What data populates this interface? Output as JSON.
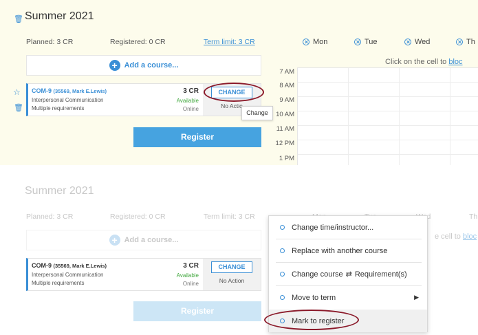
{
  "top": {
    "term_title": "Summer 2021",
    "planned": "Planned: 3 CR",
    "registered": "Registered: 0 CR",
    "term_limit": "Term limit: 3 CR",
    "days": [
      "Mon",
      "Tue",
      "Wed",
      "Th"
    ],
    "add_course": "Add a course...",
    "course": {
      "code": "COM-9",
      "detail": "(35569, Mark E.Lewis)",
      "name": "Interpersonal Communication",
      "requirements": "Multiple requirements",
      "credits": "3 CR",
      "availability": "Available",
      "mode": "Online",
      "change_label": "CHANGE",
      "action_label": "No Actio"
    },
    "tooltip": "Change",
    "register_label": "Register",
    "times": [
      "7 AM",
      "8 AM",
      "9 AM",
      "10 AM",
      "11 AM",
      "12 PM",
      "1 PM"
    ],
    "hint_text": "Click on the cell to ",
    "hint_link": "bloc"
  },
  "bottom": {
    "term_title": "Summer 2021",
    "planned": "Planned: 3 CR",
    "registered": "Registered: 0 CR",
    "term_limit": "Term limit: 3 CR",
    "days": [
      "Mon",
      "Tue",
      "Wed",
      "Th"
    ],
    "add_course": "Add a course...",
    "hint_text": "e cell to ",
    "hint_link": "bloc",
    "course": {
      "code": "COM-9",
      "detail": "(35569, Mark E.Lewis)",
      "name": "Interpersonal Communication",
      "requirements": "Multiple requirements",
      "credits": "3 CR",
      "availability": "Available",
      "mode": "Online",
      "change_label": "CHANGE",
      "action_label": "No Action"
    },
    "register_label": "Register",
    "menu": {
      "items": [
        "Change time/instructor...",
        "Replace with another course",
        "Change course",
        "Move to term",
        "Mark to register"
      ],
      "change_course_suffix": "Requirement(s)"
    }
  },
  "colors": {
    "accent": "#3a8fd6",
    "available": "#41a83e",
    "highlight_oval": "#8b1a2a",
    "top_panel_bg": "#fdfcec"
  }
}
